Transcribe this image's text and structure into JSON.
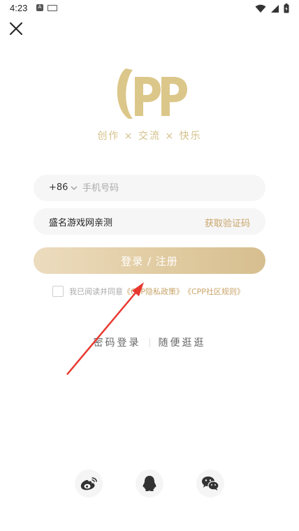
{
  "status_bar": {
    "time": "4:23"
  },
  "brand": {
    "slogan": "创作 × 交流 × 快乐",
    "logo_color": "#dcc78a"
  },
  "form": {
    "country_code": "+86",
    "phone_placeholder": "手机号码",
    "code_value": "盛名游戏网亲测",
    "get_code_label": "获取验证码",
    "login_label": "登录 / 注册"
  },
  "agreement": {
    "prefix": "我已阅读并同意",
    "privacy_link": "《CPP隐私政策》",
    "rules_link": "《CPP社区规则》"
  },
  "alt_actions": {
    "password_login": "密码登录",
    "browse": "随便逛逛"
  },
  "colors": {
    "accent": "#c8a46a",
    "arrow": "#e8382f"
  },
  "social": [
    "weibo-icon",
    "qq-icon",
    "wechat-icon"
  ]
}
